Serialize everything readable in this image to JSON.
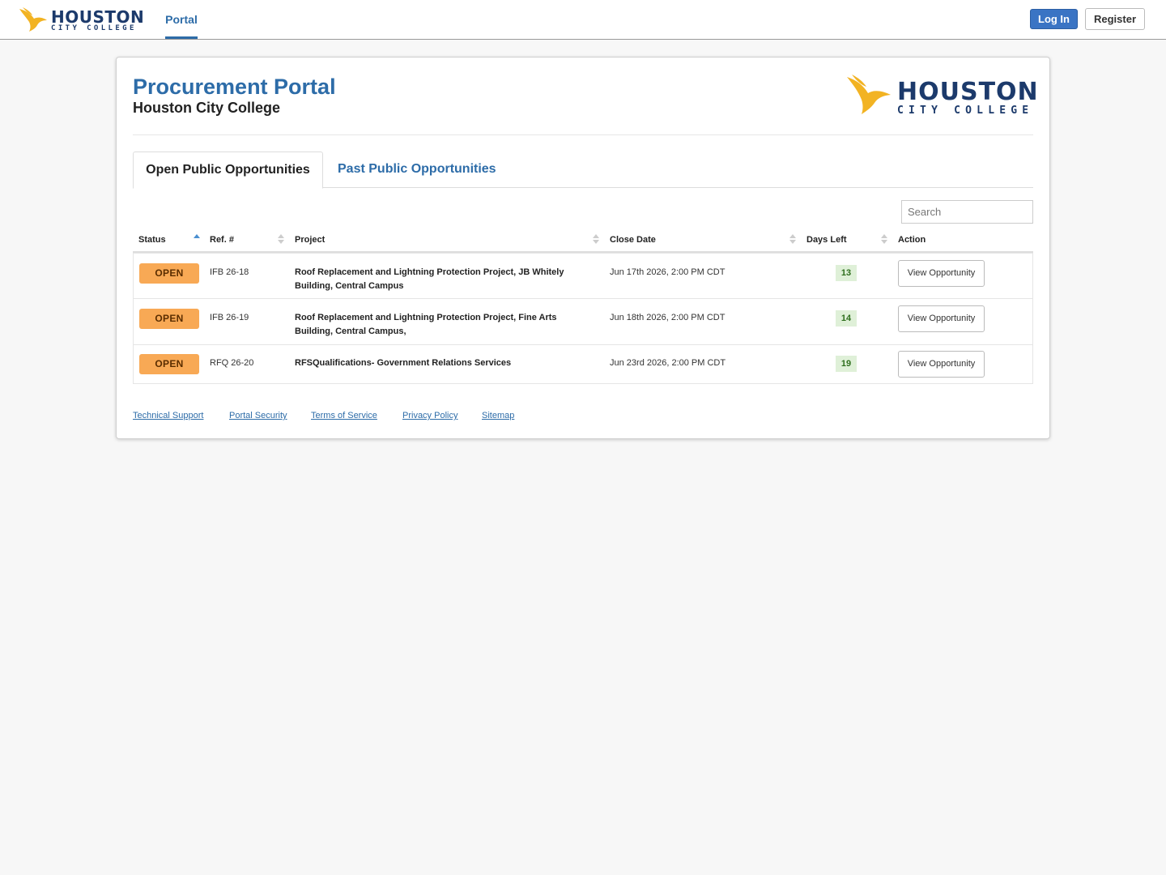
{
  "header": {
    "brand_word": "HOUSTON",
    "brand_sub": "CITY COLLEGE",
    "nav_portal": "Portal",
    "login_label": "Log In",
    "register_label": "Register"
  },
  "portal": {
    "title": "Procurement Portal",
    "subtitle": "Houston City College",
    "logo_word": "HOUSTON",
    "logo_sub": "CITY COLLEGE"
  },
  "tabs": {
    "open": "Open Public Opportunities",
    "past": "Past Public Opportunities"
  },
  "search": {
    "placeholder": "Search"
  },
  "table": {
    "columns": [
      "Status",
      "Ref. #",
      "Project",
      "Close Date",
      "Days Left",
      "Action"
    ],
    "rows": [
      {
        "status": "OPEN",
        "ref": "IFB 26-18",
        "project_line1": "Roof Replacement and Lightning Protection Project, JB Whitely",
        "project_line2": "Building, Central Campus",
        "close_date": "Jun 17th 2026, 2:00 PM CDT",
        "days_left": "13",
        "action": "View Opportunity"
      },
      {
        "status": "OPEN",
        "ref": "IFB 26-19",
        "project_line1": "Roof Replacement and Lightning Protection Project, Fine Arts",
        "project_line2": "Building, Central Campus,",
        "close_date": "Jun 18th 2026, 2:00 PM CDT",
        "days_left": "14",
        "action": "View Opportunity"
      },
      {
        "status": "OPEN",
        "ref": "RFQ 26-20",
        "project_line1": "RFSQualifications- Government Relations Services",
        "project_line2": "",
        "close_date": "Jun 23rd 2026, 2:00 PM CDT",
        "days_left": "19",
        "action": "View Opportunity"
      }
    ]
  },
  "footer": {
    "links": [
      "Technical Support",
      "Portal Security",
      "Terms of Service",
      "Privacy Policy",
      "Sitemap"
    ]
  },
  "colors": {
    "brand_blue": "#2d6ca8",
    "navy": "#1c3a6b",
    "gold": "#f2b323",
    "open_badge": "#f8a955",
    "days_badge": "#dff0d8"
  }
}
